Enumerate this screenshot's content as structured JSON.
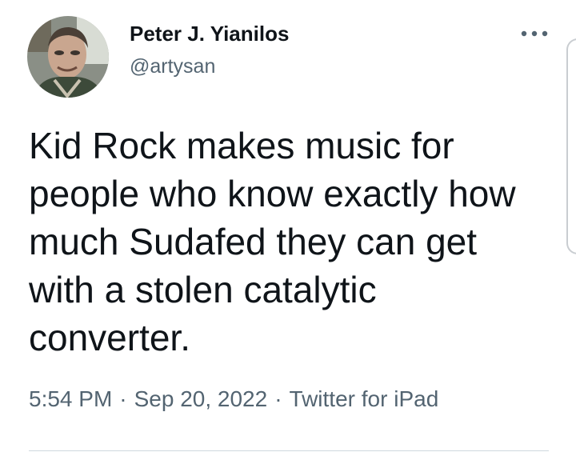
{
  "author": {
    "display_name": "Peter J. Yianilos",
    "handle": "@artysan"
  },
  "tweet": {
    "text": "Kid Rock makes music for\npeople who know exactly how\nmuch Sudafed they can get\nwith a stolen catalytic\nconverter.",
    "time": "5:54 PM",
    "date": "Sep 20, 2022",
    "source": "Twitter for iPad",
    "separator": "·"
  },
  "icons": {
    "more": "more-horizontal-icon",
    "avatar": "user-avatar"
  },
  "colors": {
    "text_primary": "#0f1419",
    "text_secondary": "#536471",
    "divider": "#cfd9de",
    "background": "#ffffff"
  }
}
